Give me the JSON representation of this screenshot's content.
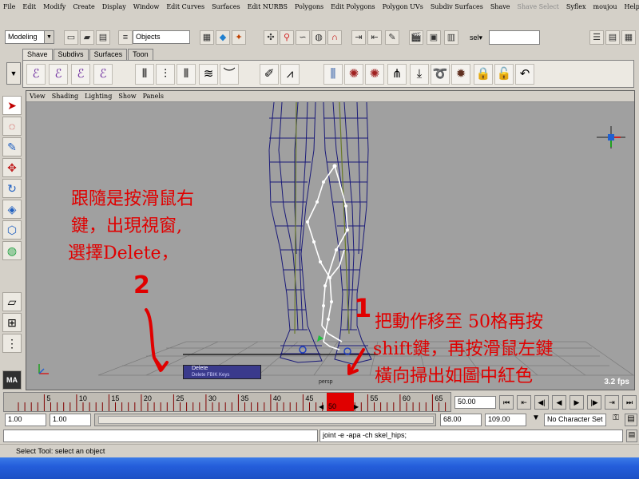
{
  "menubar": {
    "items": [
      {
        "label": "File",
        "dim": false
      },
      {
        "label": "Edit",
        "dim": false
      },
      {
        "label": "Modify",
        "dim": false
      },
      {
        "label": "Create",
        "dim": false
      },
      {
        "label": "Display",
        "dim": false
      },
      {
        "label": "Window",
        "dim": false
      },
      {
        "label": "Edit Curves",
        "dim": false
      },
      {
        "label": "Surfaces",
        "dim": false
      },
      {
        "label": "Edit NURBS",
        "dim": false
      },
      {
        "label": "Polygons",
        "dim": false
      },
      {
        "label": "Edit Polygons",
        "dim": false
      },
      {
        "label": "Polygon UVs",
        "dim": false
      },
      {
        "label": "Subdiv Surfaces",
        "dim": false
      },
      {
        "label": "Shave",
        "dim": false
      },
      {
        "label": "Shave Select",
        "dim": true
      },
      {
        "label": "Syflex",
        "dim": false
      },
      {
        "label": "moujou",
        "dim": false
      },
      {
        "label": "Help",
        "dim": false
      }
    ]
  },
  "statusline": {
    "mode": "Modeling",
    "selection_mask": "Objects",
    "sel_label": "sel▾"
  },
  "shelf": {
    "tabs": [
      "Shave",
      "Subdivs",
      "Surfaces",
      "Toon"
    ],
    "active_tab": "Shave"
  },
  "viewport": {
    "menu": [
      "View",
      "Shading",
      "Lighting",
      "Show",
      "Panels"
    ],
    "camera_label": "persp",
    "fps": "3.2 fps",
    "context_menu": {
      "item1": "Delete",
      "item2": "Delete FBIK Keys"
    },
    "annotations": {
      "step2_number": "2",
      "step2_lines": [
        "跟隨是按滑鼠右",
        "鍵，出現視窗,",
        "選擇Delete，"
      ],
      "step1_number": "1",
      "step1_lines": [
        "把動作移至 50格再按",
        "shift鍵，再按滑鼠左鍵",
        "橫向掃出如圖中紅色"
      ]
    },
    "colors": {
      "annotation": "#e00000",
      "mesh": "#202080",
      "skeleton": "#ffffff"
    }
  },
  "timeline": {
    "ticks": [
      "5",
      "10",
      "15",
      "20",
      "25",
      "30",
      "35",
      "40",
      "45",
      "50",
      "55",
      "60",
      "65"
    ],
    "current_frame": "50.00",
    "highlight_label": "50",
    "highlight_color": "#e00000"
  },
  "range": {
    "start": "1.00",
    "playback_start": "1.00",
    "playback_end": "68.00",
    "end": "109.00",
    "character_set": "No Character Set"
  },
  "cmdline": {
    "feedback": "joint -e -apa -ch skel_hips;"
  },
  "helpline": {
    "text": "Select Tool: select an object"
  }
}
